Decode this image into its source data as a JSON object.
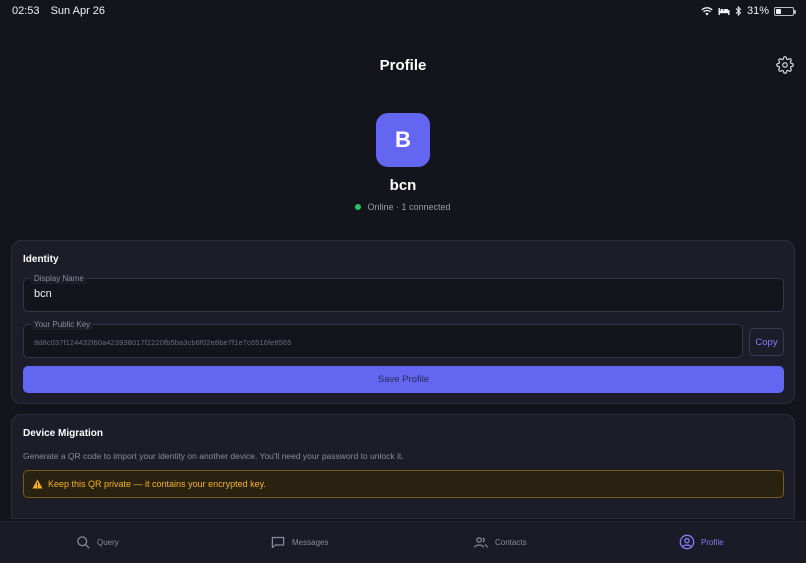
{
  "status_bar": {
    "time": "02:53",
    "date": "Sun Apr 26",
    "battery": "31%",
    "battery_level": 0.31,
    "icons": [
      "wifi-icon",
      "bed-icon",
      "bluetooth-icon",
      "battery-icon"
    ]
  },
  "header": {
    "title": "Profile",
    "settings_icon": "gear-icon"
  },
  "profile": {
    "avatar_letter": "B",
    "avatar_color": "#6366f1",
    "username": "bcn",
    "status": "Online · 1 connected",
    "status_color": "#22c55e"
  },
  "identity": {
    "title": "Identity",
    "display_name_label": "Display Name",
    "display_name_value": "bcn",
    "public_key_label": "Your Public Key",
    "public_key_value": "8d8c037f124432f60a423938017f2220fb5ba3cb6f02e8be7f1e7c6516fe8565",
    "copy_label": "Copy",
    "save_label": "Save Profile"
  },
  "migration": {
    "title": "Device Migration",
    "description": "Generate a QR code to import your identity on another device. You'll need your password to unlock it.",
    "warning": "Keep this QR private — it contains your encrypted key.",
    "warning_icon": "warning-icon"
  },
  "tabs": [
    {
      "label": "Query",
      "icon": "search-icon",
      "active": false
    },
    {
      "label": "Messages",
      "icon": "message-icon",
      "active": false
    },
    {
      "label": "Contacts",
      "icon": "users-icon",
      "active": false
    },
    {
      "label": "Profile",
      "icon": "user-circle-icon",
      "active": true
    }
  ],
  "colors": {
    "accent": "#6366f1",
    "background": "#14141d",
    "card": "#1d1d2a",
    "warning": "#f5b324"
  }
}
